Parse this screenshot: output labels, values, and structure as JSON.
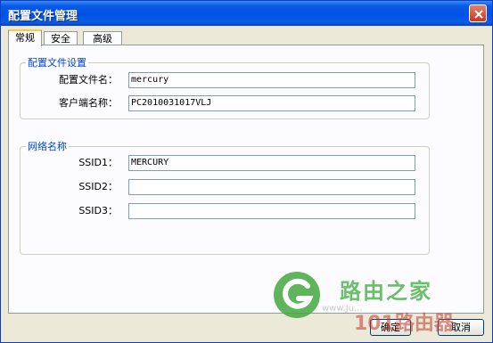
{
  "window": {
    "title": "配置文件管理"
  },
  "tabs": [
    {
      "label": "常规"
    },
    {
      "label": "安全"
    },
    {
      "label": "高级"
    }
  ],
  "profile_group": {
    "legend": "配置文件设置",
    "profile_name_label": "配置文件名：",
    "profile_name_value": "mercury",
    "client_name_label": "客户端名称：",
    "client_name_value": "PC2010031017VLJ"
  },
  "network_group": {
    "legend": "网络名称",
    "ssid1_label": "SSID1：",
    "ssid1_value": "MERCURY",
    "ssid2_label": "SSID2：",
    "ssid2_value": "",
    "ssid3_label": "SSID3：",
    "ssid3_value": ""
  },
  "buttons": {
    "ok": "确定",
    "cancel": "取消"
  },
  "watermark": {
    "brand": "路由之家",
    "site": "101路由器",
    "url": "www.Ju..."
  },
  "colors": {
    "titlebar": "#0a5ae8",
    "legend": "#0046d5",
    "watermark_green": "#4caf50"
  },
  "icons": {
    "close": "close-icon",
    "logo": "router-home-logo-icon"
  }
}
